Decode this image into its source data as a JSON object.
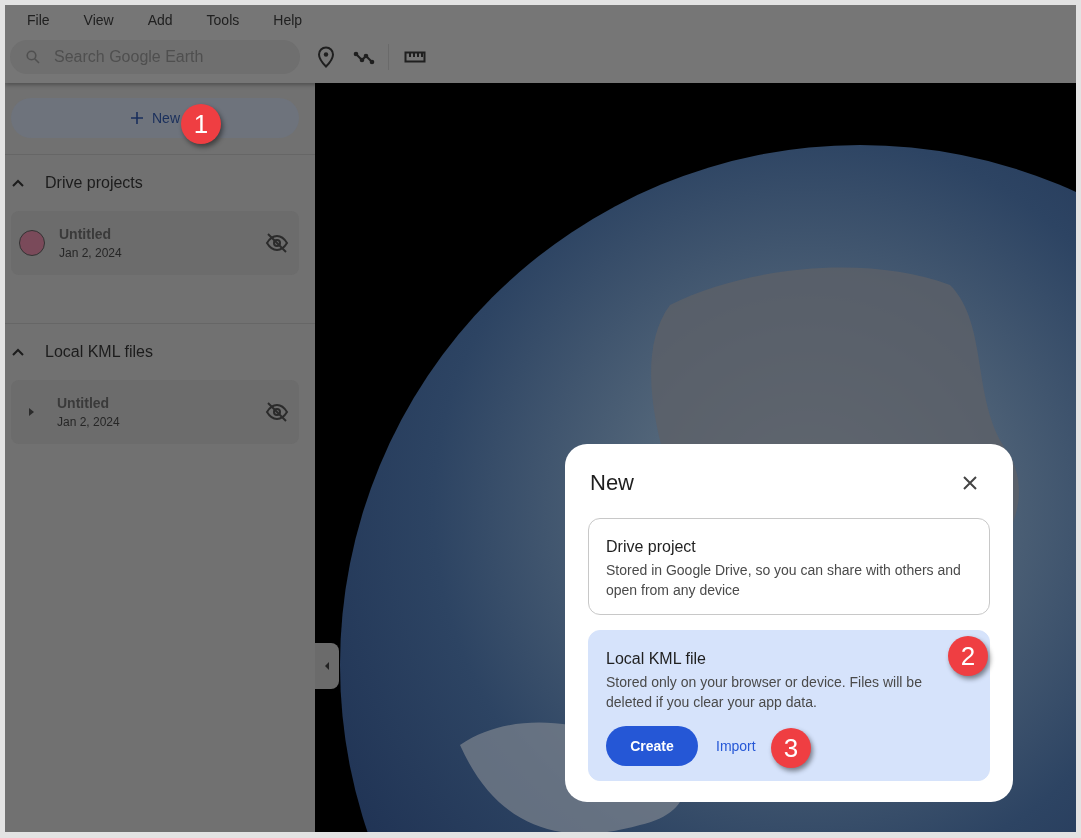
{
  "menu": [
    "File",
    "View",
    "Add",
    "Tools",
    "Help"
  ],
  "search": {
    "placeholder": "Search Google Earth"
  },
  "new_button": {
    "label": "New"
  },
  "sections": [
    {
      "title": "Drive projects",
      "expanded": true,
      "items": [
        {
          "kind": "avatar",
          "title": "Untitled",
          "date": "Jan 2, 2024",
          "visible": false
        }
      ]
    },
    {
      "title": "Local KML files",
      "expanded": true,
      "items": [
        {
          "kind": "folder",
          "title": "Untitled",
          "date": "Jan 2, 2024",
          "visible": false
        }
      ]
    }
  ],
  "dialog": {
    "title": "New",
    "options": [
      {
        "title": "Drive project",
        "description": "Stored in Google Drive, so you can share with others and open from any device",
        "selected": false
      },
      {
        "title": "Local KML file",
        "description": "Stored only on your browser or device. Files will be deleted if you clear your app data.",
        "selected": true,
        "primary_action": "Create",
        "secondary_action": "Import"
      }
    ]
  },
  "callouts": [
    "1",
    "2",
    "3"
  ]
}
